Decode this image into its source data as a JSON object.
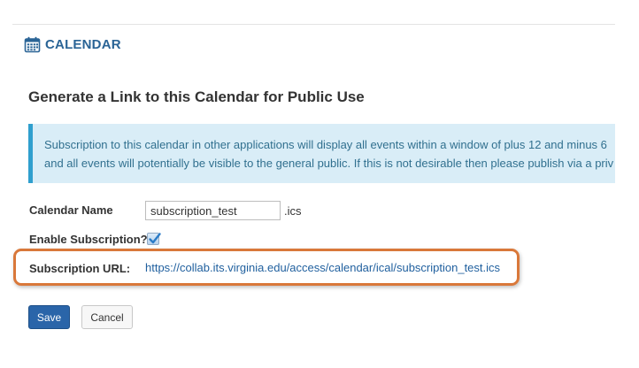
{
  "header": {
    "icon": "calendar-icon",
    "title": "CALENDAR"
  },
  "main": {
    "heading": "Generate a Link to this Calendar for Public Use",
    "info_lines": [
      "Subscription to this calendar in other applications will display all events within a window of plus 12 and minus 6",
      "and all events will potentially be visible to the general public. If this is not desirable then please publish via a priv"
    ],
    "calendar_name_label": "Calendar Name",
    "calendar_name_value": "subscription_test",
    "calendar_ext": ".ics",
    "enable_label": "Enable Subscription?",
    "enable_checked": true,
    "url_label": "Subscription URL:",
    "url_value": "https://collab.its.virginia.edu/access/calendar/ical/subscription_test.ics"
  },
  "buttons": {
    "save": "Save",
    "cancel": "Cancel"
  },
  "colors": {
    "accent": "#2a6496",
    "info_background": "#d9edf7",
    "info_border": "#2f9fce",
    "highlight": "#d9783a",
    "primary_button": "#2a65a9"
  }
}
